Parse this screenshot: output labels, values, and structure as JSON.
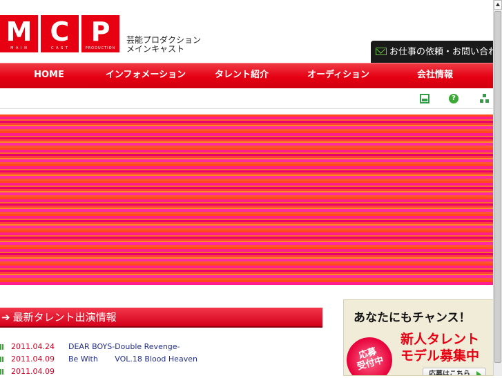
{
  "logo": {
    "letters": [
      {
        "char": "M",
        "sub": "M A I N"
      },
      {
        "char": "C",
        "sub": "C A S T"
      },
      {
        "char": "P",
        "sub": "PRODUCTION"
      }
    ],
    "tagline_line1": "芸能プロダクション",
    "tagline_line2": "メインキャスト",
    "brand_color": "#e60012"
  },
  "contact": {
    "label": "お仕事の依頼・お問い合わせ",
    "icon": "mail-icon"
  },
  "nav": {
    "items": [
      "HOME",
      "インフォメーション",
      "タレント紹介",
      "オーディション",
      "会社情報"
    ]
  },
  "utility_icons": [
    "print-icon",
    "help-icon",
    "sitemap-icon"
  ],
  "news": {
    "heading_arrow": "➔",
    "heading": "最新タレント出演情報",
    "items": [
      {
        "date": "2011.04.24",
        "title": "DEAR BOYS-Double Revenge-"
      },
      {
        "date": "2011.04.09",
        "title": "Be With       VOL.18 Blood Heaven"
      },
      {
        "date": "2011.04.09",
        "title": ""
      }
    ]
  },
  "ad": {
    "headline": "あなたにもチャンス！",
    "line1": "新人タレント",
    "line2": "モデル募集中",
    "burst": "応募\n受付中",
    "cta": "応募はこちら"
  },
  "colors": {
    "accent_red": "#e60012",
    "link_blue": "#1f2b8a",
    "date_red": "#cc0022",
    "icon_green": "#3aa935"
  }
}
